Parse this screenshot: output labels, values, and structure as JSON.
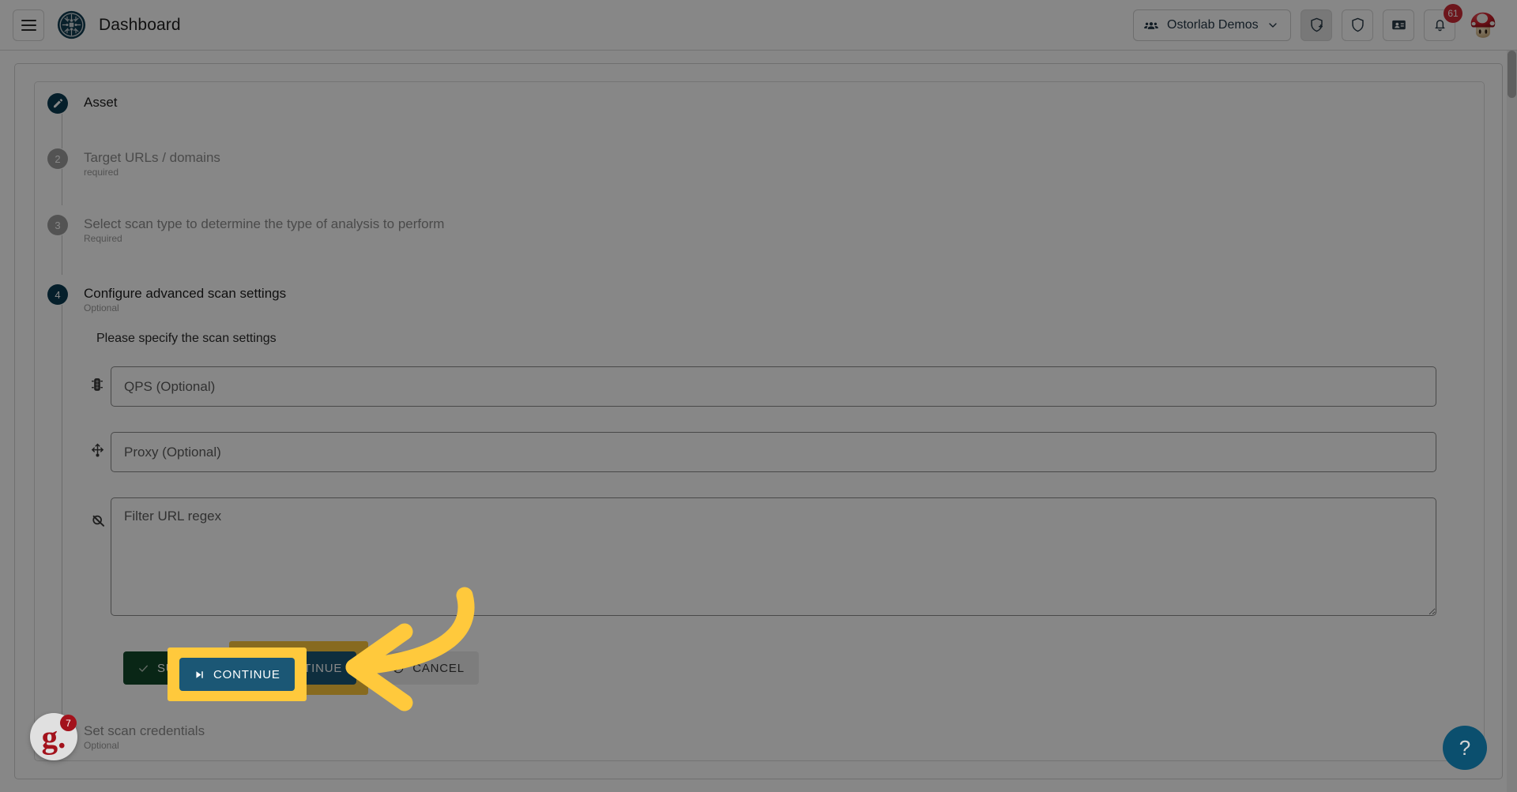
{
  "header": {
    "menu_icon": "hamburger-menu-icon",
    "logo_icon": "ostorlab-circuit-logo",
    "title": "Dashboard",
    "org_selector": {
      "icon": "people-group-icon",
      "label": "Ostorlab Demos",
      "chevron": "chevron-down-icon"
    },
    "actions": [
      {
        "icon": "shield-plus-icon",
        "name": "add-scan-button",
        "pressed": true
      },
      {
        "icon": "shield-icon",
        "name": "security-button",
        "pressed": false
      },
      {
        "icon": "ticket-id-icon",
        "name": "tickets-button",
        "pressed": false
      }
    ],
    "notifications": {
      "icon": "bell-icon",
      "count": "61"
    },
    "avatar": {
      "icon": "mushroom-avatar",
      "name": "user-avatar"
    }
  },
  "wizard": {
    "steps": [
      {
        "index": "1",
        "marker": "pencil-icon",
        "label": "Asset",
        "sub": "",
        "state": "completed"
      },
      {
        "index": "2",
        "marker": "2",
        "label": "Target URLs / domains",
        "sub": "required",
        "state": "pending"
      },
      {
        "index": "3",
        "marker": "3",
        "label": "Select scan type to determine the type of analysis to perform",
        "sub": "Required",
        "state": "pending"
      },
      {
        "index": "4",
        "marker": "4",
        "label": "Configure advanced scan settings",
        "sub": "Optional",
        "state": "active"
      },
      {
        "index": "5",
        "marker": "5",
        "label": "Set scan credentials",
        "sub": "Optional",
        "state": "pending"
      }
    ],
    "active_step_body": {
      "hint": "Please specify the scan settings",
      "fields": [
        {
          "name": "qps-field",
          "icon": "traffic-light-icon",
          "placeholder": "QPS (Optional)",
          "value": "",
          "type": "input"
        },
        {
          "name": "proxy-field",
          "icon": "network-nodes-icon",
          "placeholder": "Proxy (Optional)",
          "value": "",
          "type": "input"
        },
        {
          "name": "filter-url-regex-field",
          "icon": "filter-off-icon",
          "placeholder": "Filter URL regex",
          "value": "",
          "type": "textarea"
        }
      ],
      "buttons": {
        "submit": {
          "icon": "check-icon",
          "label": "SUBMIT"
        },
        "continue": {
          "icon": "skip-next-icon",
          "label": "CONTINUE"
        },
        "cancel": {
          "icon": "block-icon",
          "label": "CANCEL"
        }
      }
    }
  },
  "overlays": {
    "feedback_widget": {
      "icon": "gleap-g-logo",
      "letter": "g.",
      "count": "7"
    },
    "help_button": {
      "icon": "question-mark-icon",
      "label": "?"
    },
    "highlight_color": "#ffc93c",
    "arrow": "curved-left-arrow-annotation"
  },
  "colors": {
    "accent_teal": "#1b5775",
    "brand_dark": "#0b3c52",
    "submit_green": "#11482a",
    "badge_red": "#cf2a36",
    "highlight_yellow": "#ffc93c"
  }
}
